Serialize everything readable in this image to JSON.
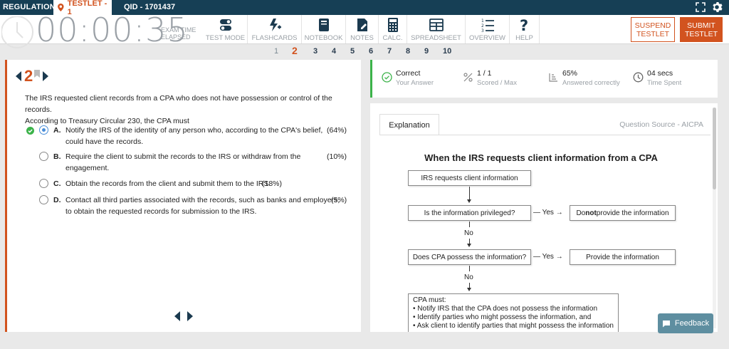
{
  "topbar": {
    "section": "REGULATION",
    "testlet": "TESTLET - 1",
    "qid": "QID - 1701437"
  },
  "toolbar": {
    "timer": "00:00:35",
    "timer_label_1": "EXAM TIME",
    "timer_label_2": "ELAPSED",
    "tools": [
      {
        "label": "TEST MODE",
        "icon": "toggle-icon"
      },
      {
        "label": "FLASHCARDS",
        "icon": "flashcard-icon"
      },
      {
        "label": "NOTEBOOK",
        "icon": "notebook-icon"
      },
      {
        "label": "NOTES",
        "icon": "notes-icon"
      },
      {
        "label": "CALC.",
        "icon": "calculator-icon"
      },
      {
        "label": "SPREADSHEET",
        "icon": "spreadsheet-icon"
      },
      {
        "label": "OVERVIEW",
        "icon": "overview-icon"
      },
      {
        "label": "HELP",
        "icon": "help-icon"
      }
    ],
    "suspend_1": "SUSPEND",
    "suspend_2": "TESTLET",
    "submit_1": "SUBMIT",
    "submit_2": "TESTLET"
  },
  "qnav": [
    "1",
    "2",
    "3",
    "4",
    "5",
    "6",
    "7",
    "8",
    "9",
    "10"
  ],
  "question": {
    "number": "2",
    "stem_1": "The IRS requested client records from a CPA who does not have possession or control of the records.",
    "stem_2": "According to Treasury Circular 230, the CPA must",
    "choices": [
      {
        "letter": "A.",
        "line1": "Notify the IRS of the identity of any person who, according to the CPA's belief,",
        "line2": "could have the records.",
        "pct": "(64%)"
      },
      {
        "letter": "B.",
        "line1": "Require the client to submit the records to the IRS or withdraw from the",
        "line2": "engagement.",
        "pct": "(10%)"
      },
      {
        "letter": "C.",
        "line1": "Obtain the records from the client and submit them to the IRS.",
        "line2": "",
        "pct": "(18%)"
      },
      {
        "letter": "D.",
        "line1": "Contact all third parties associated with the records, such as banks and employers,",
        "line2": "to obtain the requested records for submission to the IRS.",
        "pct": "(5%)"
      }
    ]
  },
  "summary": {
    "answer_value": "Correct",
    "answer_label": "Your Answer",
    "score_value": "1 / 1",
    "score_label": "Scored / Max",
    "pct_value": "65%",
    "pct_label": "Answered correctly",
    "time_value": "04 secs",
    "time_label": "Time Spent"
  },
  "explanation": {
    "tab": "Explanation",
    "source": "Question Source - AICPA",
    "title": "When the IRS requests client information from a CPA",
    "box1": "IRS requests client information",
    "box2": "Is the information privileged?",
    "yes1": "— Yes →",
    "box3_a": "Do ",
    "box3_b": "not",
    "box3_c": " provide the information",
    "no1": "No",
    "box4": "Does CPA possess the information?",
    "yes2": "— Yes →",
    "box5": "Provide the information",
    "no2": "No",
    "cpa_title": "CPA must:",
    "cpa_1": "• Notify IRS that the CPA does not possess the information",
    "cpa_2": "• Identify parties who might possess the information, and",
    "cpa_3": "• Ask client to identify parties that might possess the information"
  },
  "feedback": "Feedback"
}
